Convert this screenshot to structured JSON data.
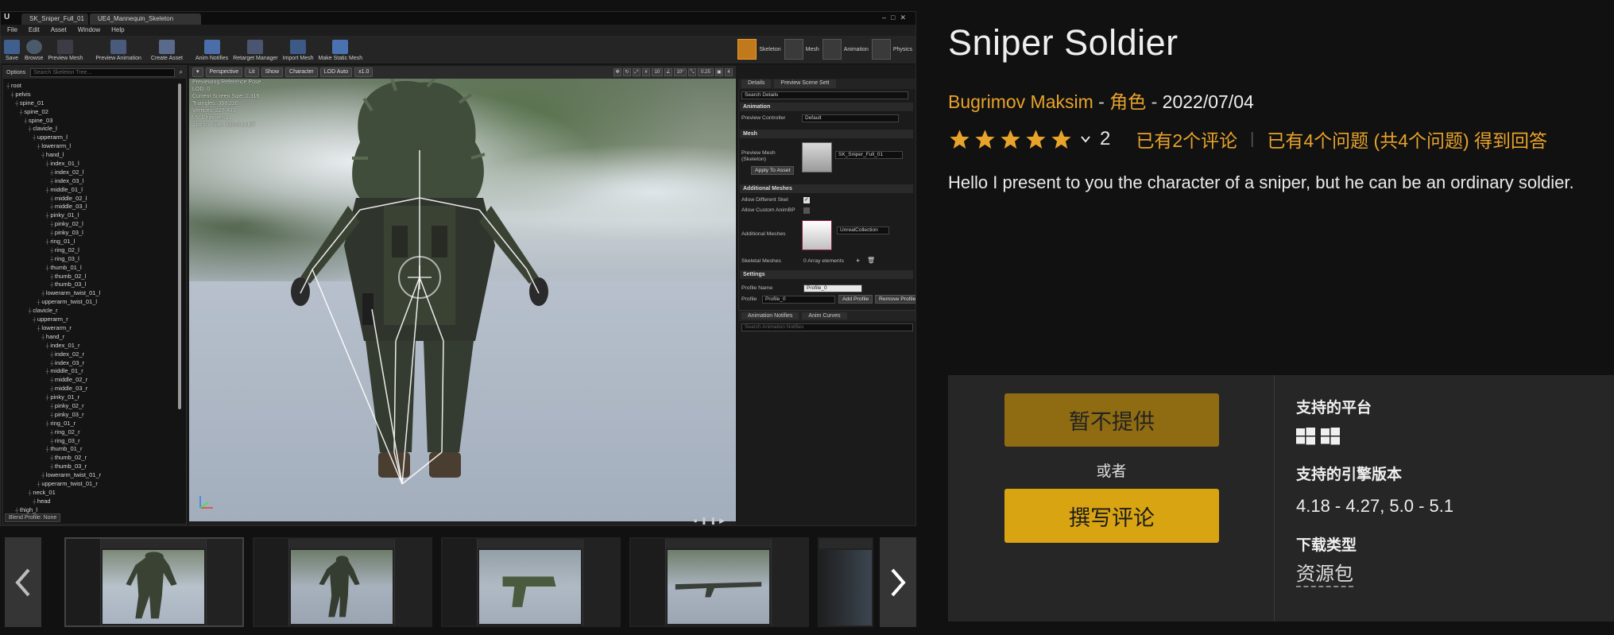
{
  "editor": {
    "tabs": [
      "SK_Sniper_Full_01",
      "UE4_Mannequin_Skeleton"
    ],
    "menu": [
      "File",
      "Edit",
      "Asset",
      "Window",
      "Help"
    ],
    "toolbar": [
      "Save",
      "Browse",
      "Preview Mesh",
      "Preview Animation",
      "Create Asset",
      "Anim Notifies",
      "Retarget Manager",
      "Import Mesh",
      "Make Static Mesh"
    ],
    "modes": [
      "Skeleton",
      "Mesh",
      "Animation",
      "Physics"
    ],
    "tree_options": "Options",
    "tree_search": "Search Skeleton Tree...",
    "bones": [
      "root",
      "pelvis",
      "spine_01",
      "spine_02",
      "spine_03",
      "clavicle_l",
      "upperarm_l",
      "lowerarm_l",
      "hand_l",
      "index_01_l",
      "index_02_l",
      "index_03_l",
      "middle_01_l",
      "middle_02_l",
      "middle_03_l",
      "pinky_01_l",
      "pinky_02_l",
      "pinky_03_l",
      "ring_01_l",
      "ring_02_l",
      "ring_03_l",
      "thumb_01_l",
      "thumb_02_l",
      "thumb_03_l",
      "lowerarm_twist_01_l",
      "upperarm_twist_01_l",
      "clavicle_r",
      "upperarm_r",
      "lowerarm_r",
      "hand_r",
      "index_01_r",
      "index_02_r",
      "index_03_r",
      "middle_01_r",
      "middle_02_r",
      "middle_03_r",
      "pinky_01_r",
      "pinky_02_r",
      "pinky_03_r",
      "ring_01_r",
      "ring_02_r",
      "ring_03_r",
      "thumb_01_r",
      "thumb_02_r",
      "thumb_03_r",
      "lowerarm_twist_01_r",
      "upperarm_twist_01_r",
      "neck_01",
      "head",
      "thigh_l"
    ],
    "tree_footer": "Blend Profile: None",
    "viewport_buttons": [
      "Perspective",
      "Lit",
      "Show",
      "Character",
      "LOD Auto",
      "x1.0"
    ],
    "viewport_right": [
      "10",
      "10°",
      "0.25",
      "4"
    ],
    "viewport_info": "Previewing Reference Pose\nLOD: 0\nCurrent Screen Size: 1.315\nTriangles: 368,226\nVertices: 227,433\nUV Channels: 1\nApprox Size: 230x91x187",
    "details_tabs": [
      "Details",
      "Preview Scene Sett"
    ],
    "details_search": "Search Details",
    "sec_animation": "Animation",
    "preview_controller_label": "Preview Controller",
    "preview_controller_value": "Default",
    "sec_mesh": "Mesh",
    "preview_mesh_label": "Preview Mesh (Skeleton)",
    "preview_mesh_value": "SK_Sniper_Full_01",
    "apply_to_asset": "Apply To Asset",
    "sec_additional": "Additional Meshes",
    "allow_diff_skel": "Allow Different Skel",
    "allow_custom_anim": "Allow Custom AnimBP",
    "additional_meshes_label": "Additional Meshes",
    "additional_meshes_value": "UnrealCollection",
    "skeletal_meshes_label": "Skeletal Meshes",
    "skeletal_meshes_value": "0 Array elements",
    "sec_settings": "Settings",
    "profile_name_label": "Profile Name",
    "profile_name_value": "Profile_0",
    "profile_label": "Profile",
    "profile_value": "Profile_0",
    "add_profile": "Add Profile",
    "remove_profile": "Remove Profile",
    "anim_tabs": [
      "Animation Notifies",
      "Anim Curves"
    ],
    "anim_search": "Search Animation Notifies"
  },
  "product": {
    "title": "Sniper Soldier",
    "author": "Bugrimov Maksim",
    "separator": " - ",
    "category": "角色",
    "date": "2022/07/04",
    "rating_count": "2",
    "reviews_link": "已有2个评论",
    "divider": "|",
    "questions_link": "已有4个问题 (共4个问题) 得到回答",
    "description": "Hello I present to you the character of a sniper, but he can be an ordinary soldier."
  },
  "purchase": {
    "unavailable_label": "暂不提供",
    "or_label": "或者",
    "write_review_label": "撰写评论",
    "platforms_label": "支持的平台",
    "engine_label": "支持的引擎版本",
    "engine_versions": "4.18 - 4.27, 5.0 - 5.1",
    "download_label": "下载类型",
    "download_type": "资源包"
  },
  "colors": {
    "accent": "#e8a32a",
    "button_disabled": "#8f6c11",
    "button_primary": "#d9a411",
    "panel_bg": "#262626",
    "page_bg": "#111111"
  },
  "icons": {
    "prev": "chevron-left-icon",
    "next": "chevron-right-icon",
    "star": "star-icon",
    "platform": "windows-icon",
    "rating_dropdown": "chevron-down-icon"
  }
}
